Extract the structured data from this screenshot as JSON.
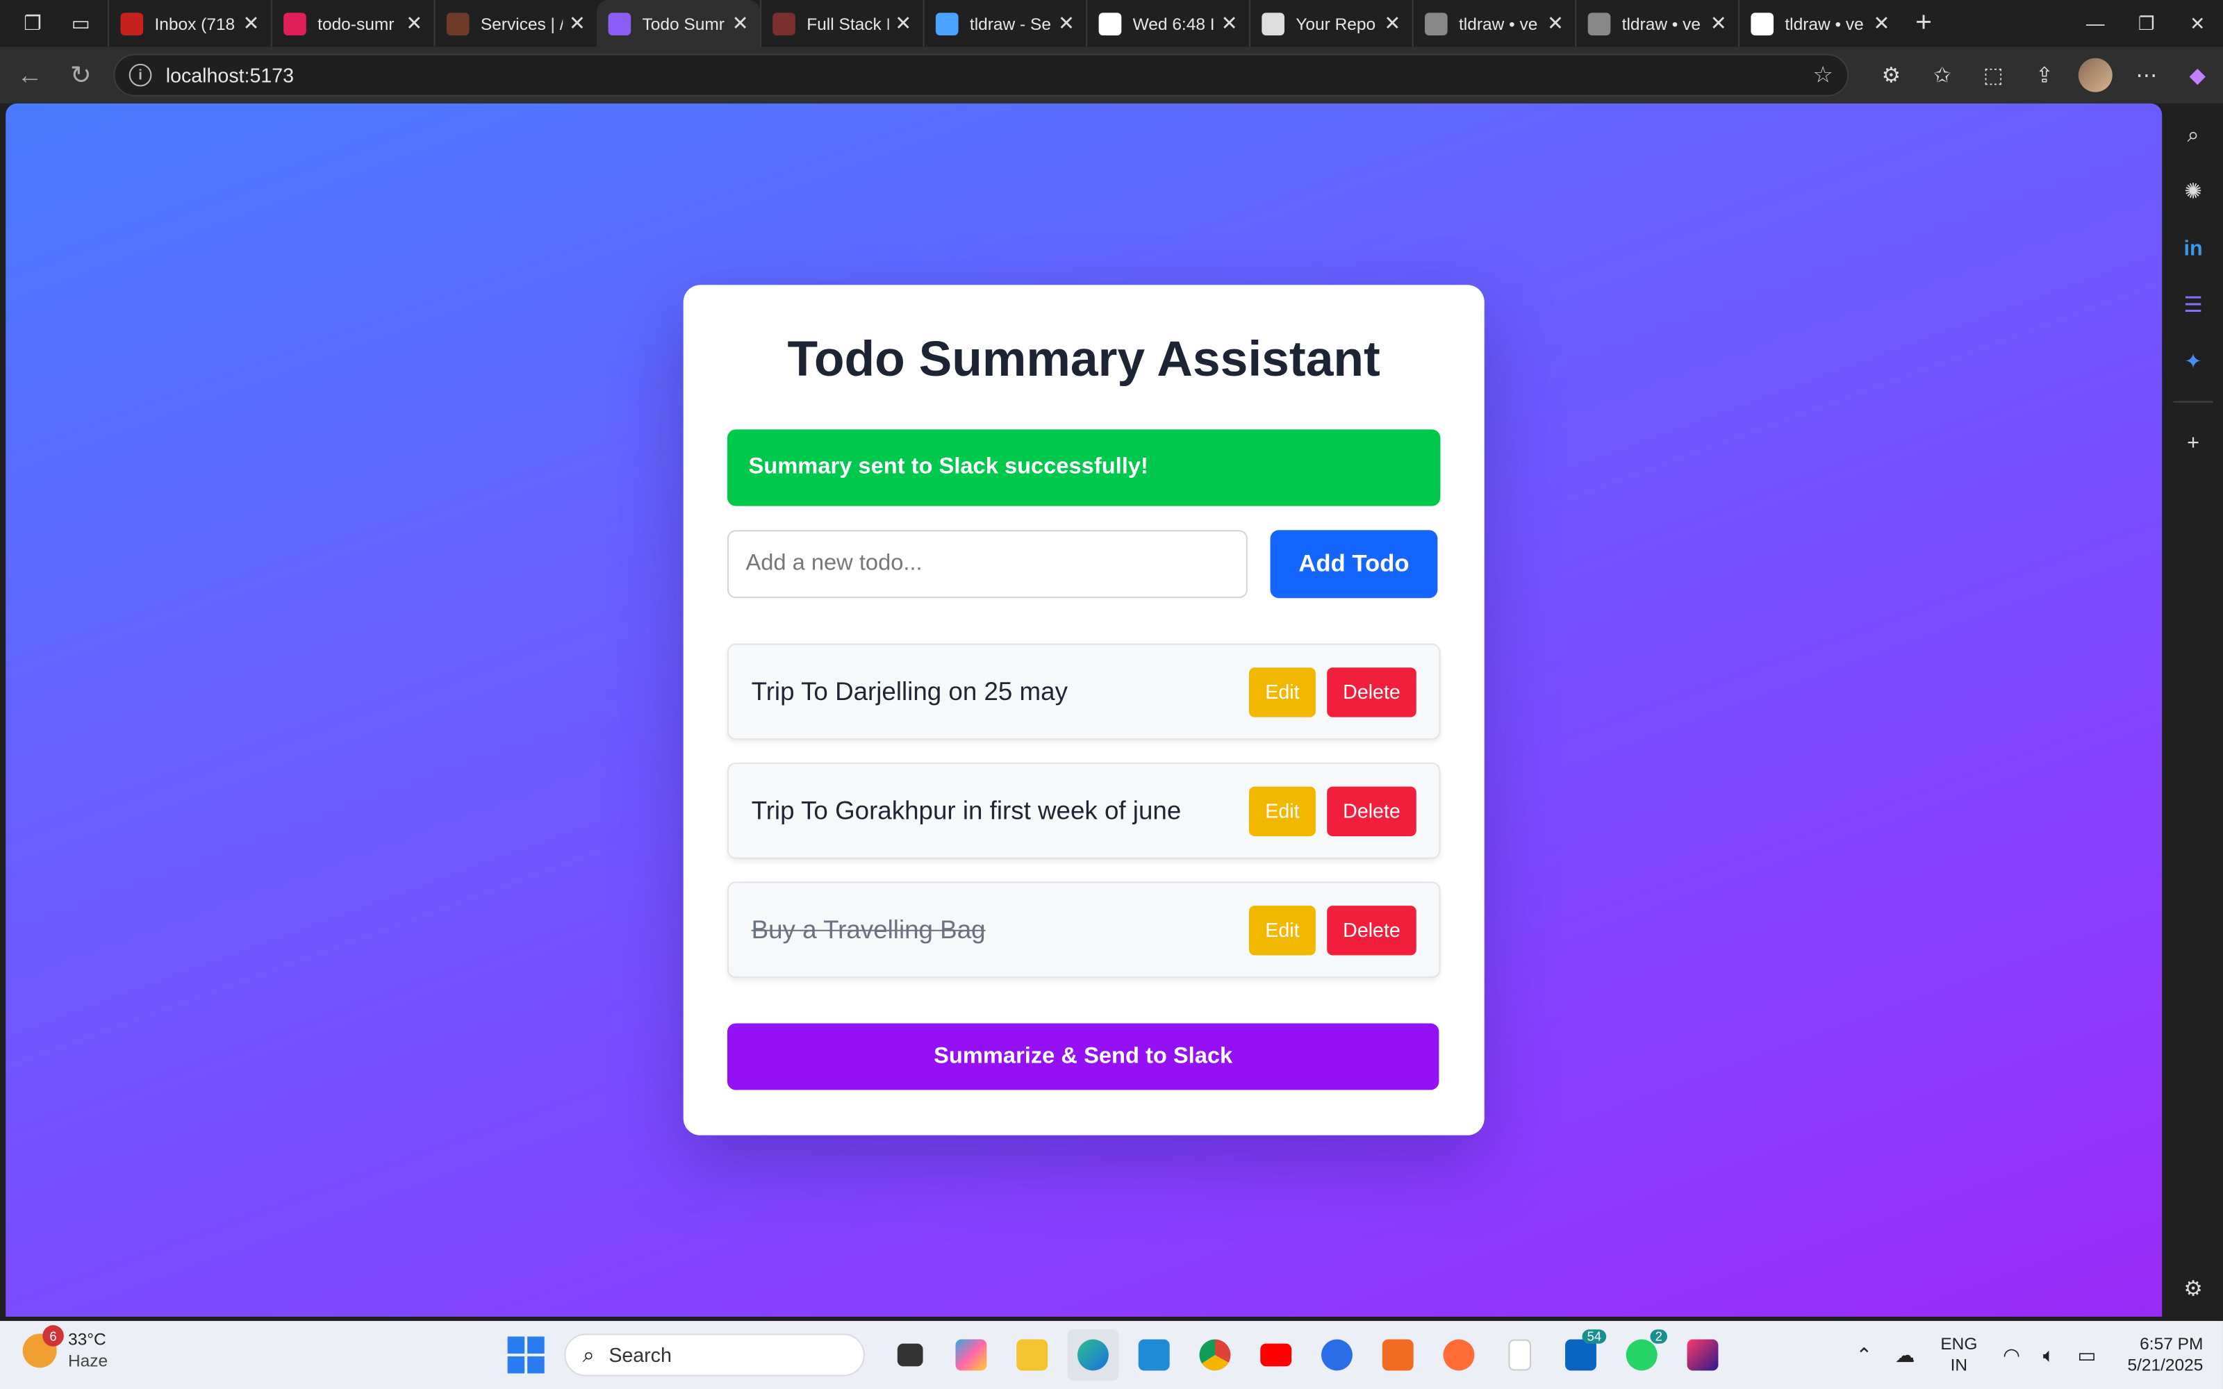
{
  "browser": {
    "tabs": [
      {
        "title": "",
        "color": "#444"
      },
      {
        "title": "Inbox (718",
        "color": "#c5221f"
      },
      {
        "title": "todo-sumr",
        "color": "#e01e5a"
      },
      {
        "title": "Services | /",
        "color": "#6e3a2a"
      },
      {
        "title": "Todo Sumr",
        "color": "#8b5cf6",
        "active": true
      },
      {
        "title": "Full Stack I",
        "color": "#7a2e2e"
      },
      {
        "title": "tldraw - Se",
        "color": "#4aa3ff"
      },
      {
        "title": "Wed 6:48 I",
        "color": "#ffffff"
      },
      {
        "title": "Your Repo",
        "color": "#dddddd"
      },
      {
        "title": "tldraw • ve",
        "color": "#888888"
      },
      {
        "title": "tldraw • ve",
        "color": "#888888"
      },
      {
        "title": "tldraw • ve",
        "color": "#ffffff"
      }
    ],
    "url": "localhost:5173"
  },
  "app": {
    "title": "Todo Summary Assistant",
    "alert": "Summary sent to Slack successfully!",
    "input_placeholder": "Add a new todo...",
    "add_button": "Add Todo",
    "edit_label": "Edit",
    "delete_label": "Delete",
    "todos": [
      {
        "text": "Trip To Darjelling on 25 may",
        "completed": false
      },
      {
        "text": "Trip To Gorakhpur in first week of june",
        "completed": false
      },
      {
        "text": "Buy a Travelling Bag",
        "completed": true
      }
    ],
    "summarize_button": "Summarize & Send to Slack"
  },
  "taskbar": {
    "weather_temp": "33°C",
    "weather_desc": "Haze",
    "weather_badge": "6",
    "search_label": "Search",
    "badge_outlook": "54",
    "badge_whatsapp": "2",
    "lang_line1": "ENG",
    "lang_line2": "IN",
    "time": "6:57 PM",
    "date": "5/21/2025"
  }
}
